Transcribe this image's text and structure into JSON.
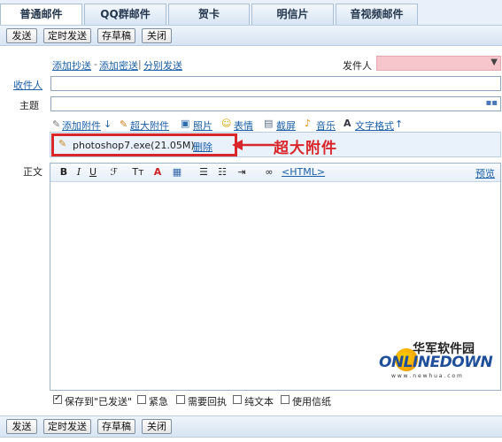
{
  "tabs": [
    {
      "label": "普通邮件",
      "active": true
    },
    {
      "label": "QQ群邮件"
    },
    {
      "label": "贺卡"
    },
    {
      "label": "明信片"
    },
    {
      "label": "音视频邮件"
    }
  ],
  "toolbar": {
    "send": "发送",
    "timed_send": "定时发送",
    "save_draft": "存草稿",
    "close": "关闭"
  },
  "compose": {
    "add_cc": "添加抄送",
    "sep1": "-",
    "add_bcc": "添加密送",
    "sep2": "|",
    "separate_send": "分别发送",
    "sender_label": "发件人",
    "to_label": "收件人",
    "subject_label": "主题",
    "body_label": "正文"
  },
  "attach_toolbar": {
    "add_attachment": "添加附件",
    "arrow": "↓",
    "super_attachment": "超大附件",
    "photo": "照片",
    "emoji": "表情",
    "screenshot": "截屏",
    "music": "音乐",
    "text_format": "文字格式",
    "text_format_arrow": "↑"
  },
  "attachment": {
    "filename": "photoshop7.exe(21.05M)",
    "delete": "删除"
  },
  "annotation": {
    "label": "超大附件"
  },
  "editor": {
    "html_link": "<HTML>",
    "preview": "预览"
  },
  "options": {
    "save_sent": "保存到\"已发送\"",
    "urgent": "紧急",
    "read_receipt": "需要回执",
    "plain_text": "纯文本",
    "use_stationery": "使用信纸"
  },
  "watermark": {
    "cn": "华军软件园",
    "logo": "ONLINEDOWN",
    "url": "w w w . n e w h u a . c o m"
  },
  "colors": {
    "accent": "#1a5fa8",
    "highlight": "#d8262b",
    "sender_field": "#f7c6cc"
  }
}
